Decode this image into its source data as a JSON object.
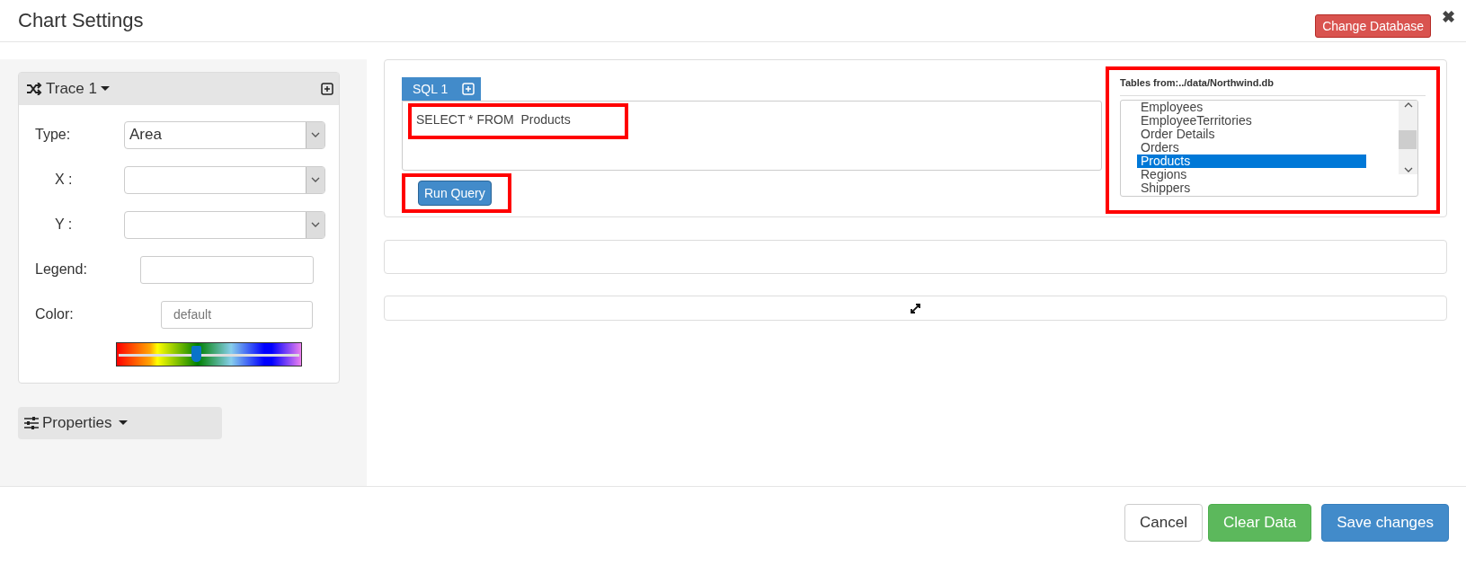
{
  "window": {
    "title": "Chart Settings",
    "close": "✖"
  },
  "header_button": "Change Database",
  "trace": {
    "title": "Trace 1",
    "fields": [
      {
        "kind": "select",
        "label": "Type:",
        "value": "Area"
      },
      {
        "kind": "select",
        "label": "X :"
      },
      {
        "kind": "select",
        "label": "Y :"
      },
      {
        "kind": "text",
        "label": "Legend:"
      },
      {
        "kind": "text",
        "label": "Color:",
        "placeholder": "default"
      }
    ],
    "color_slider": {
      "level": 0.43
    }
  },
  "properties": {
    "title": "Properties"
  },
  "query": {
    "tab": "SQL 1",
    "text": "SELECT * FROM  Products",
    "highlighted": true,
    "run_button": "Run Query",
    "run_highlighted": true
  },
  "tables": {
    "title": "Tables from:../data/Northwind.db",
    "highlighted": true,
    "items": [
      {
        "label": "Employees",
        "selected": false
      },
      {
        "label": "EmployeeTerritories",
        "selected": false
      },
      {
        "label": "Order Details",
        "selected": false
      },
      {
        "label": "Orders",
        "selected": false
      },
      {
        "label": "Products",
        "selected": true
      },
      {
        "label": "Regions",
        "selected": false
      },
      {
        "label": "Shippers",
        "selected": false
      }
    ]
  },
  "footer": {
    "buttons": [
      {
        "label": "Cancel",
        "kind": "default"
      },
      {
        "label": "Clear Data",
        "kind": "success"
      },
      {
        "label": "Save changes",
        "kind": "primary"
      }
    ]
  }
}
